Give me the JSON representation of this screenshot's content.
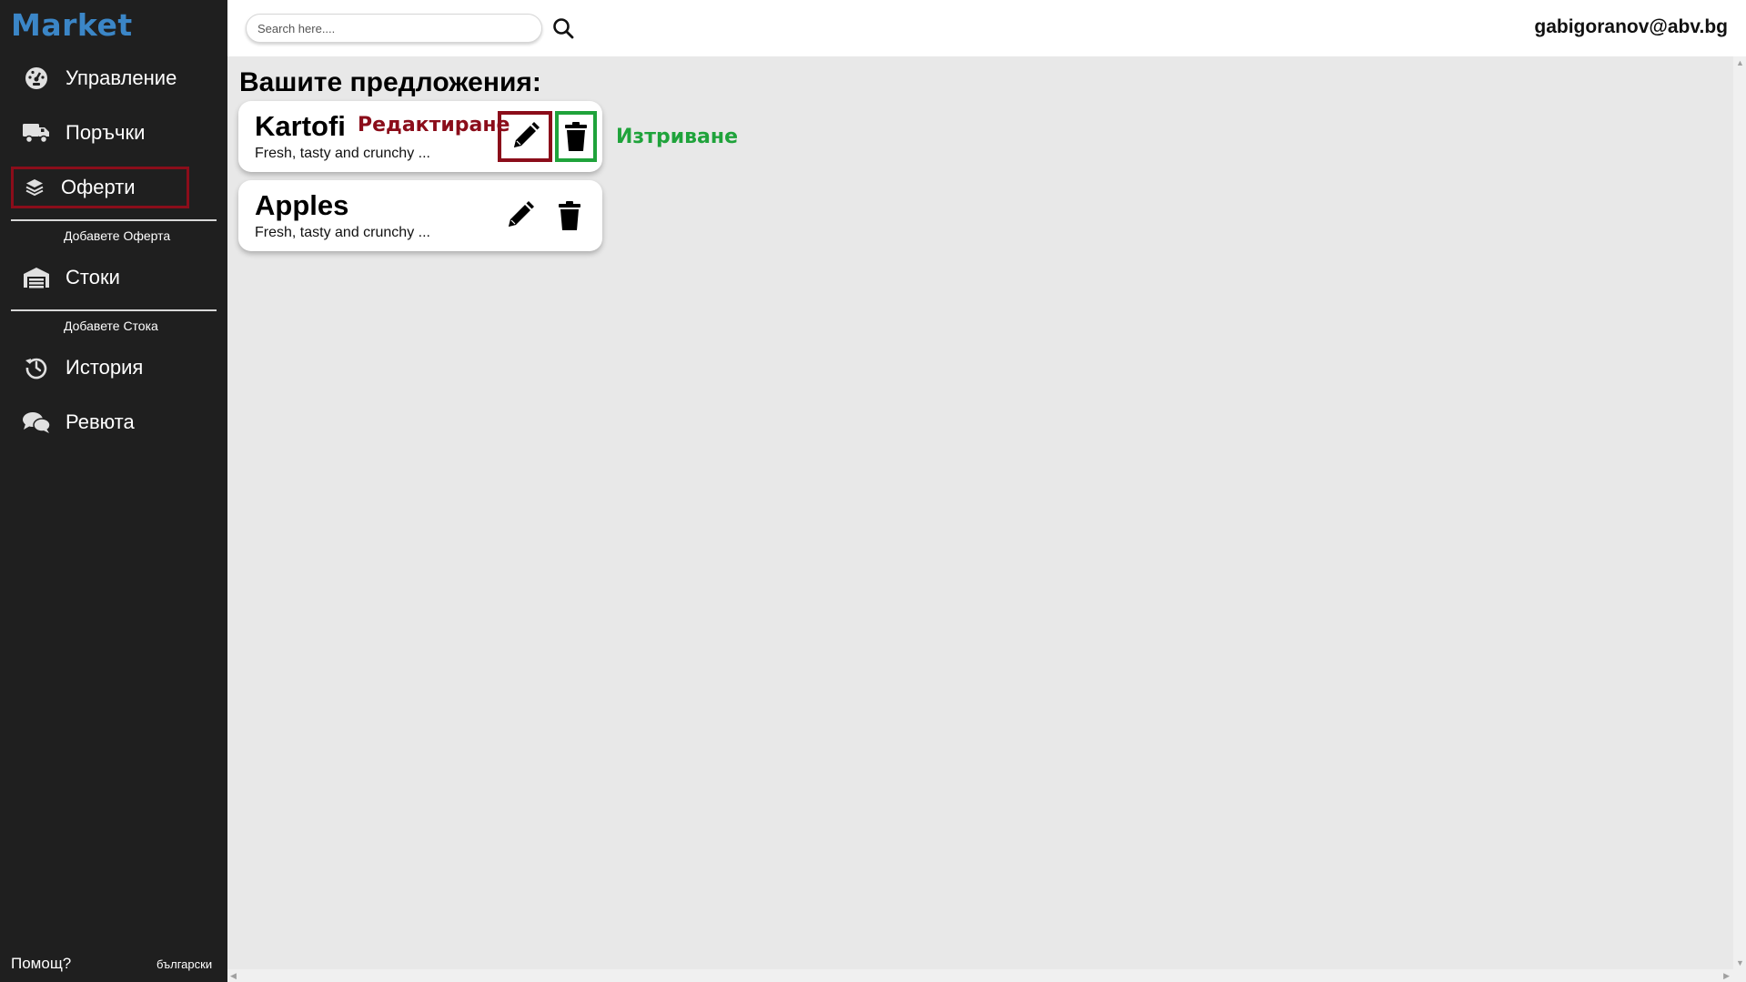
{
  "sidebar": {
    "brand": "Market",
    "items": [
      {
        "label": "Управление",
        "icon": "dashboard-icon"
      },
      {
        "label": "Поръчки",
        "icon": "truck-icon"
      },
      {
        "label": "Оферти",
        "icon": "layers-icon"
      },
      {
        "label": "Стоки",
        "icon": "warehouse-icon"
      },
      {
        "label": "История",
        "icon": "history-icon"
      },
      {
        "label": "Ревюта",
        "icon": "comments-icon"
      }
    ],
    "sub_add_offer": "Добавете Оферта",
    "sub_add_product": "Добавете Стока",
    "help": "Помощ?",
    "language": "български"
  },
  "header": {
    "search_placeholder": "Search here....",
    "user_email": "gabigoranov@abv.bg"
  },
  "main": {
    "title": "Вашите предложения:",
    "offers": [
      {
        "name": "Kartofi",
        "description": "Fresh, tasty and crunchy ..."
      },
      {
        "name": "Apples",
        "description": "Fresh, tasty and crunchy ..."
      }
    ]
  },
  "annotations": {
    "edit_label": "Редактиране",
    "delete_label": "Изтриване",
    "edit_color": "#8b0d1a",
    "delete_color": "#1fa33b"
  },
  "colors": {
    "sidebar_bg": "#1f1f1f",
    "brand": "#3b86c7",
    "main_bg": "#e8e8e8"
  }
}
